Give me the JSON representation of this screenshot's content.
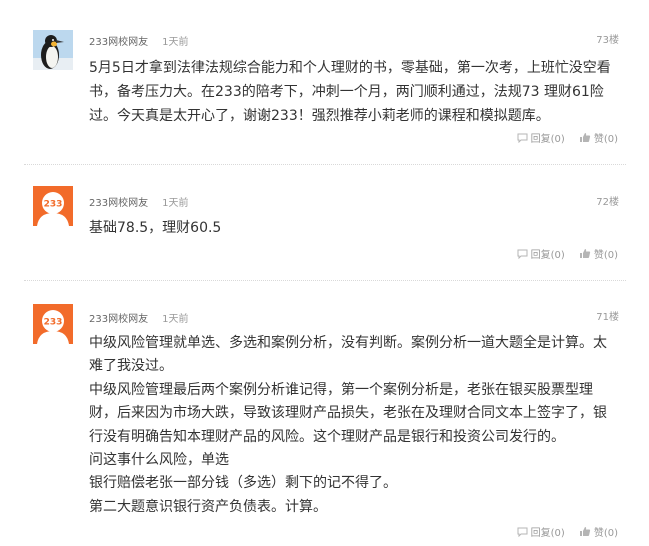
{
  "comments": [
    {
      "user": "233网校网友",
      "time": "1天前",
      "floor": "73楼",
      "avatar": "penguin-avatar",
      "lines": [
        "5月5日才拿到法律法规综合能力和个人理财的书，零基础，第一次考，上班忙没空看",
        "书，备考压力大。在233的陪考下，冲刺一个月，两门顺利通过，法规73 理财61险",
        "过。今天真是太开心了，谢谢233！强烈推荐小莉老师的课程和模拟题库。"
      ],
      "reply_label": "回复(0)",
      "like_label": "赞(0)"
    },
    {
      "user": "233网校网友",
      "time": "1天前",
      "floor": "72楼",
      "avatar": "233-logo-avatar",
      "avatar_text": "233",
      "lines": [
        "基础78.5，理财60.5"
      ],
      "reply_label": "回复(0)",
      "like_label": "赞(0)"
    },
    {
      "user": "233网校网友",
      "time": "1天前",
      "floor": "71楼",
      "avatar": "233-logo-avatar",
      "avatar_text": "233",
      "lines": [
        "中级风险管理就单选、多选和案例分析，没有判断。案例分析一道大题全是计算。太",
        "难了我没过。",
        "中级风险管理最后两个案例分析谁记得，第一个案例分析是，老张在银买股票型理",
        "财，后来因为市场大跌，导致该理财产品损失，老张在及理财合同文本上签字了，银",
        "行没有明确告知本理财产品的风险。这个理财产品是银行和投资公司发行的。",
        "问这事什么风险，单选",
        "银行赔偿老张一部分钱（多选）剩下的记不得了。",
        "第二大题意识银行资产负债表。计算。"
      ],
      "reply_label": "回复(0)",
      "like_label": "赞(0)"
    }
  ],
  "colors": {
    "avatar_orange": "#f26b2a",
    "text": "#333333",
    "meta": "#999999"
  }
}
